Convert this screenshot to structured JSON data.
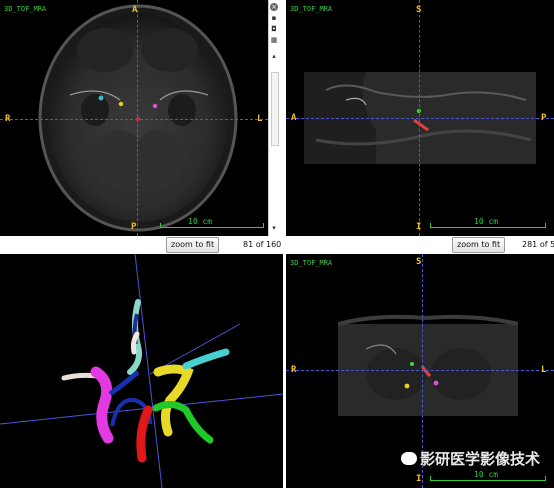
{
  "views": {
    "axial": {
      "series": "3D_TOF_MRA",
      "top": "A",
      "bottom": "P",
      "left": "R",
      "right": "L",
      "scale": "10 cm",
      "zoom_label": "zoom to fit",
      "slice": "81 of 160"
    },
    "sagittal": {
      "series": "3D_TOF_MRA",
      "top": "S",
      "bottom": "I",
      "left": "A",
      "right": "P",
      "scale": "10 cm",
      "zoom_label": "zoom to fit",
      "slice": "281 of 5"
    },
    "coronal": {
      "series": "3D_TOF_MRA",
      "top": "S",
      "bottom": "I",
      "left": "R",
      "right": "L",
      "scale": "10 cm"
    },
    "render3d": {}
  },
  "watermark": "影研医学影像技术",
  "icons": [
    "close-icon",
    "camera-icon",
    "lock-icon",
    "grid-icon",
    "scroll-up-icon",
    "scroll-down-icon"
  ],
  "colors": {
    "crosshair": "#4a55d8",
    "scale": "#2ecc40",
    "orientation": "#f0c030",
    "series": "#3ec84a"
  }
}
